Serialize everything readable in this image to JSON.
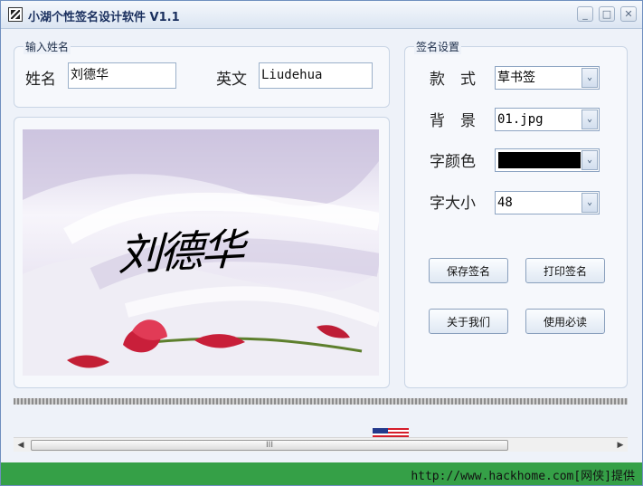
{
  "window": {
    "title": "小湖个性签名设计软件 V1.1",
    "icons": {
      "app": "app-icon",
      "minimize": "minimize-icon",
      "maximize": "maximize-icon",
      "close": "close-icon"
    },
    "glyphs": {
      "minimize": "_",
      "maximize": "□",
      "close": "✕"
    }
  },
  "input_name": {
    "group_title": "输入姓名",
    "name_label": "姓名",
    "name_value": "刘德华",
    "english_label": "英文",
    "english_value": "Liudehua"
  },
  "signature_settings": {
    "group_title": "签名设置",
    "style_label": "款　式",
    "style_value": "草书签",
    "background_label": "背　景",
    "background_value": "01.jpg",
    "font_color_label": "字颜色",
    "font_color_value": "#000000",
    "font_size_label": "字大小",
    "font_size_value": "48",
    "dropdown_icon": "chevron-down-icon",
    "dropdown_glyph": "⌄"
  },
  "buttons": {
    "save": "保存签名",
    "print": "打印签名",
    "about": "关于我们",
    "guide": "使用必读"
  },
  "preview": {
    "signature_text": "刘德华",
    "background_image": "lavender-ribbons-and-rose",
    "colors": {
      "background": "#ebe6f4",
      "rose": "#c91f3a",
      "stem": "#5d7f2d",
      "ink": "#000000"
    }
  },
  "scrollbar": {
    "left_icon": "scroll-left-icon",
    "right_icon": "scroll-right-icon",
    "thumb_grip": "III",
    "left_glyph": "◀",
    "right_glyph": "▶"
  },
  "footer": {
    "text": "http://www.hackhome.com[网侠]提供",
    "color": "#35a047"
  }
}
